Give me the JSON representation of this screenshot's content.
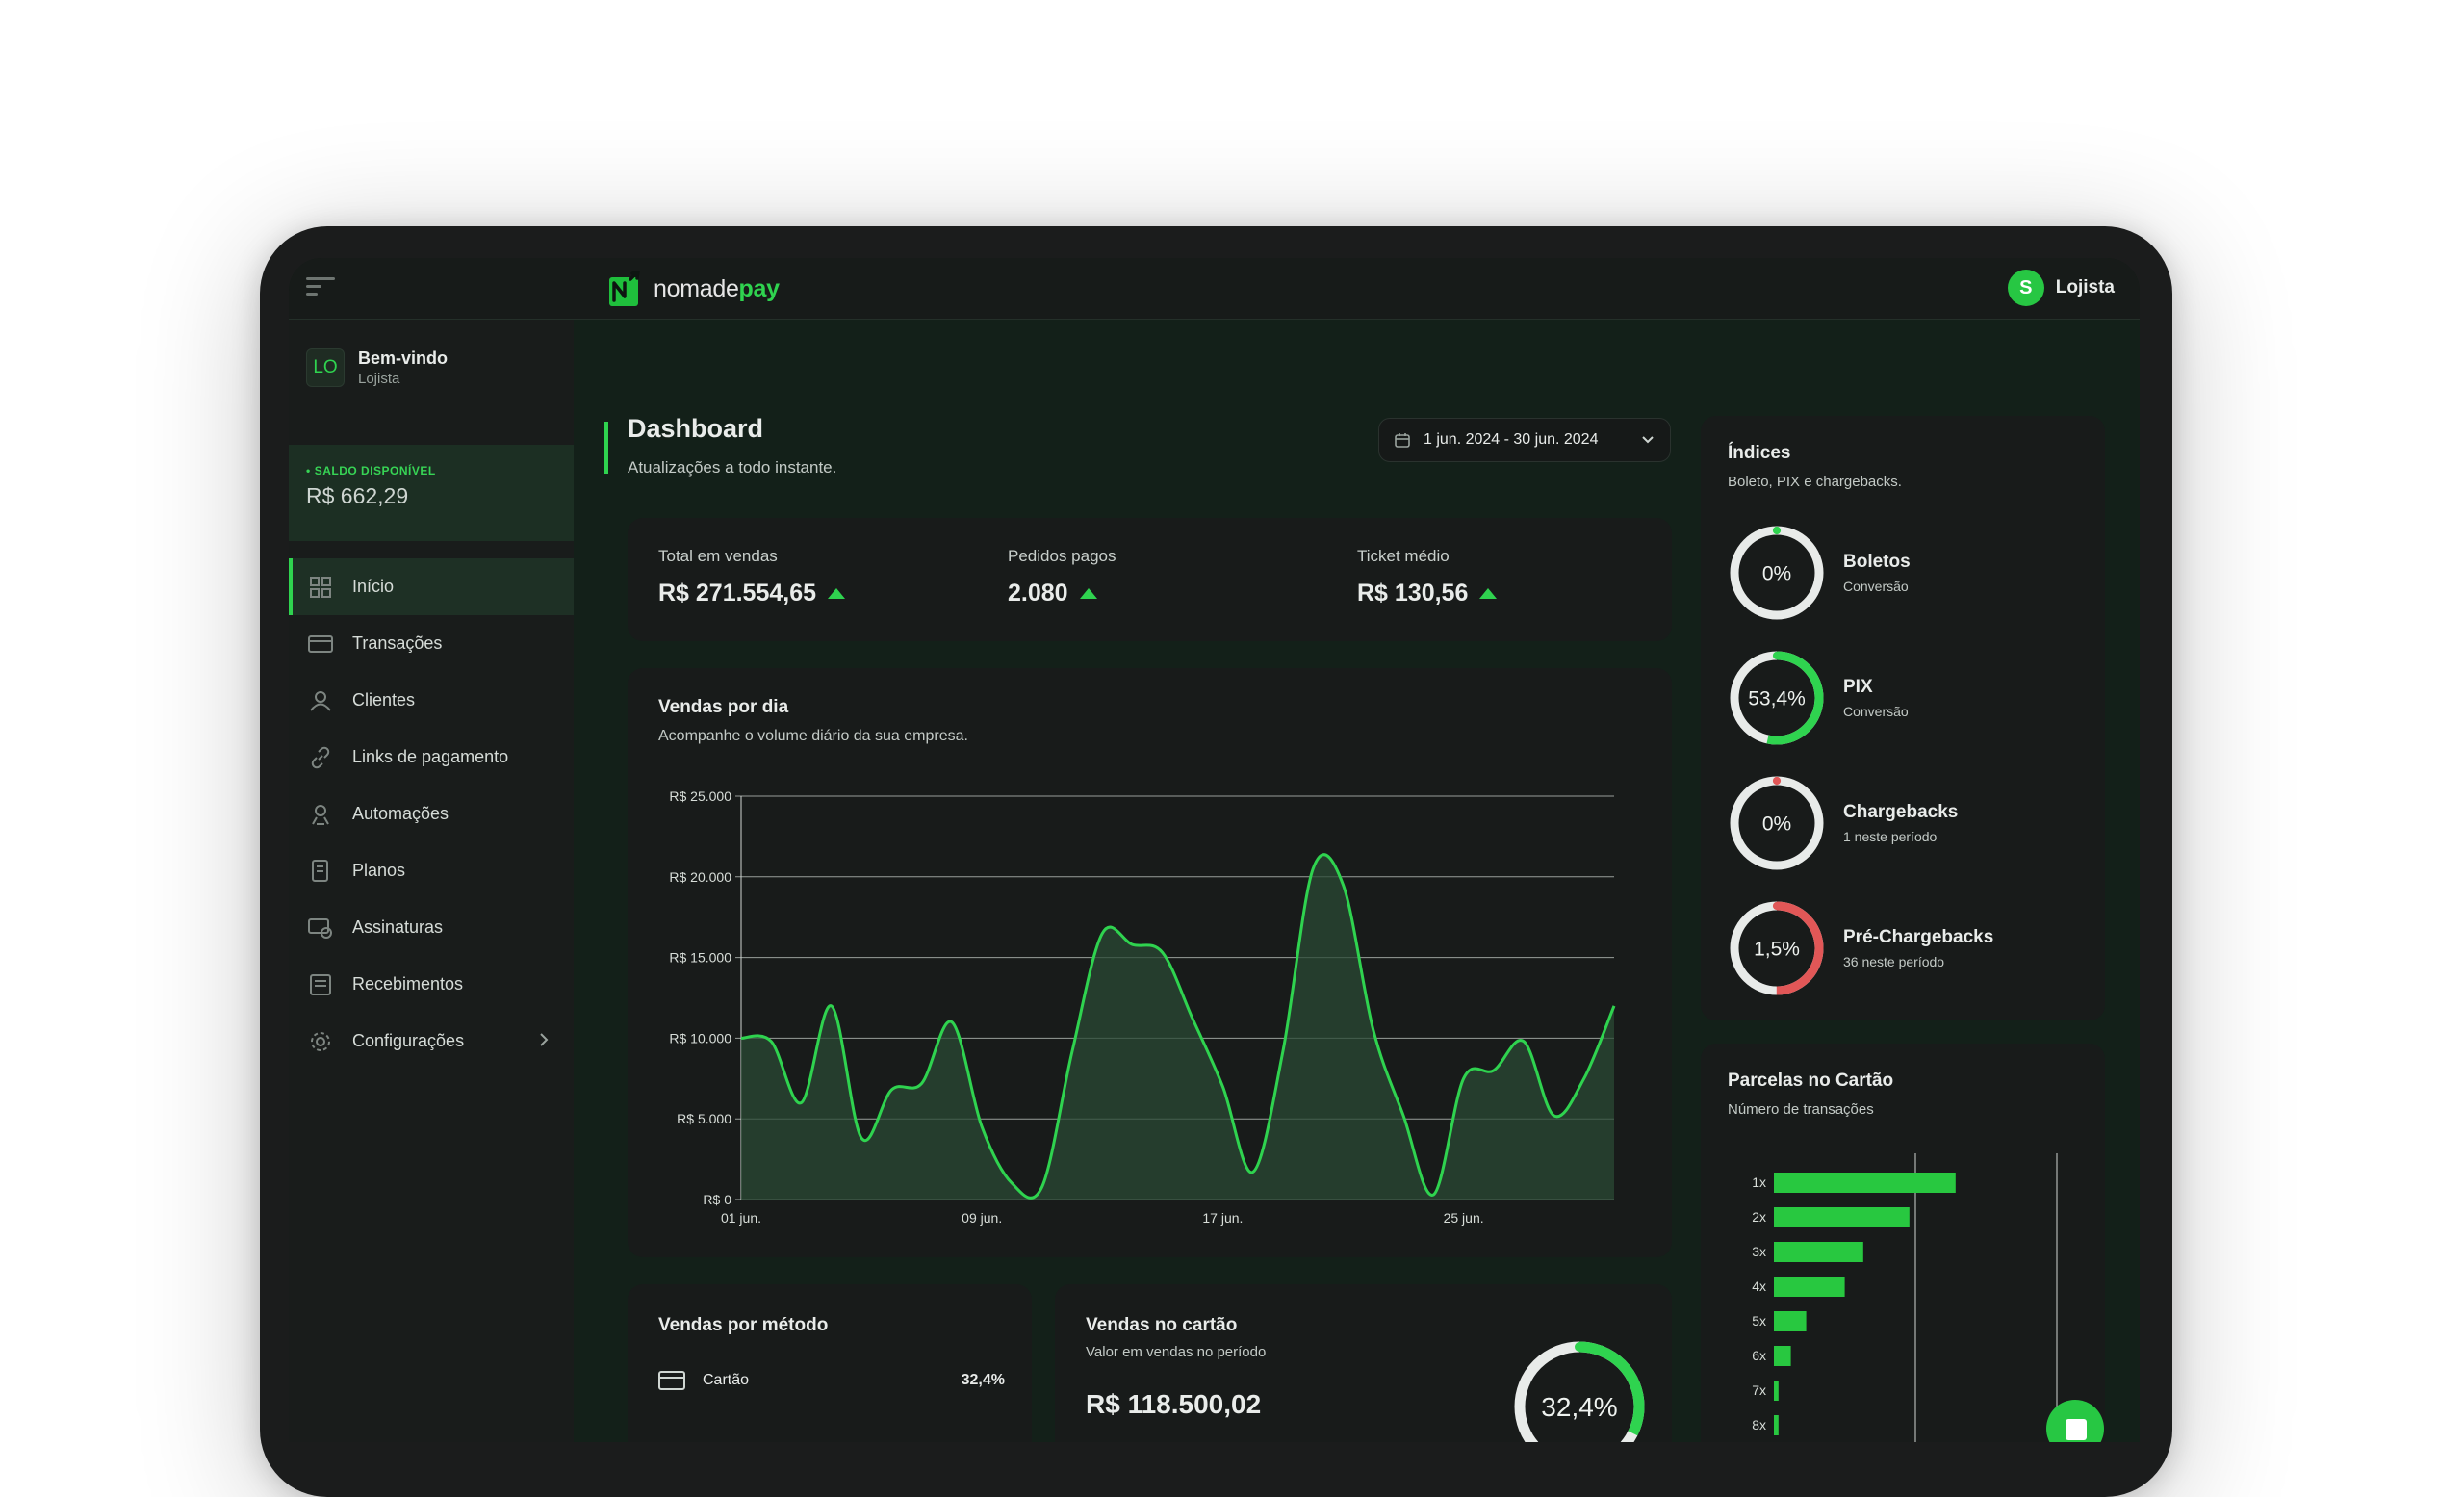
{
  "brand": {
    "name_a": "nomade",
    "name_b": "pay"
  },
  "user": {
    "initial": "S",
    "name": "Lojista"
  },
  "sidebar": {
    "badge": "LO",
    "welcome_title": "Bem-vindo",
    "welcome_sub": "Lojista",
    "balance_label": "SALDO DISPONÍVEL",
    "balance_value": "R$ 662,29",
    "items": [
      {
        "label": "Início",
        "icon": "grid-icon"
      },
      {
        "label": "Transações",
        "icon": "credit-card-icon"
      },
      {
        "label": "Clientes",
        "icon": "users-icon"
      },
      {
        "label": "Links de pagamento",
        "icon": "link-icon"
      },
      {
        "label": "Automações",
        "icon": "automation-icon"
      },
      {
        "label": "Planos",
        "icon": "document-icon"
      },
      {
        "label": "Assinaturas",
        "icon": "subscription-icon"
      },
      {
        "label": "Recebimentos",
        "icon": "receipt-icon"
      },
      {
        "label": "Configurações",
        "icon": "gear-icon"
      }
    ]
  },
  "header": {
    "title": "Dashboard",
    "subtitle": "Atualizações a todo instante.",
    "date_range": "1 jun. 2024 - 30 jun. 2024"
  },
  "stats": [
    {
      "label": "Total em vendas",
      "value": "R$ 271.554,65"
    },
    {
      "label": "Pedidos pagos",
      "value": "2.080"
    },
    {
      "label": "Ticket médio",
      "value": "R$ 130,56"
    }
  ],
  "sales_chart": {
    "title": "Vendas por dia",
    "subtitle": "Acompanhe o volume diário da sua empresa."
  },
  "chart_data": [
    {
      "type": "area",
      "title": "Vendas por dia",
      "y_ticks": [
        "R$ 25.000",
        "R$ 20.000",
        "R$ 15.000",
        "R$ 10.000",
        "R$ 5.000",
        "R$ 0"
      ],
      "x_ticks": [
        "01 jun.",
        "09 jun.",
        "17 jun.",
        "25 jun."
      ],
      "ylim": [
        0,
        25000
      ],
      "x": [
        1,
        2,
        3,
        4,
        5,
        6,
        7,
        8,
        9,
        10,
        11,
        12,
        13,
        14,
        15,
        16,
        17,
        18,
        19,
        20,
        21,
        22,
        23,
        24,
        25,
        26,
        27,
        28,
        29,
        30
      ],
      "values": [
        10000,
        9800,
        6000,
        12000,
        3800,
        6800,
        7200,
        11000,
        4500,
        1000,
        800,
        9200,
        16500,
        15800,
        15300,
        11200,
        7000,
        1700,
        9200,
        20500,
        19500,
        10500,
        5200,
        300,
        7500,
        8000,
        9800,
        5200,
        7500,
        12000
      ],
      "grid": true,
      "colors": {
        "line": "#2fd34f"
      }
    },
    {
      "type": "bar",
      "title": "Parcelas no Cartão",
      "categories": [
        "1x",
        "2x",
        "3x",
        "4x",
        "5x",
        "6x",
        "7x",
        "8x"
      ],
      "values": [
        118,
        88,
        58,
        46,
        21,
        11,
        3,
        3
      ]
    }
  ],
  "indices": {
    "title": "Índices",
    "subtitle": "Boleto, PIX e chargebacks.",
    "items": [
      {
        "label": "0%",
        "name": "Boletos",
        "sub": "Conversão",
        "fraction": 0.0,
        "color": "#2fd34f",
        "tip": "#2fd34f"
      },
      {
        "label": "53,4%",
        "name": "PIX",
        "sub": "Conversão",
        "fraction": 0.534,
        "color": "#2fd34f",
        "tip": "#2fd34f"
      },
      {
        "label": "0%",
        "name": "Chargebacks",
        "sub": "1 neste período",
        "fraction": 0.0,
        "color": "#e15757",
        "tip": "#e15757"
      },
      {
        "label": "1,5%",
        "name": "Pré-Chargebacks",
        "sub": "36 neste período",
        "fraction": 0.5,
        "color": "#e15757",
        "tip": "#e15757"
      }
    ]
  },
  "parcelas": {
    "title": "Parcelas no Cartão",
    "subtitle": "Número de transações"
  },
  "metodo": {
    "title": "Vendas por método",
    "row_label": "Cartão",
    "row_value": "32,4%"
  },
  "cartao": {
    "title": "Vendas no cartão",
    "subtitle": "Valor em vendas no período",
    "value": "R$ 118.500,02",
    "donut_label": "32,4%",
    "donut_fraction": 0.324
  }
}
